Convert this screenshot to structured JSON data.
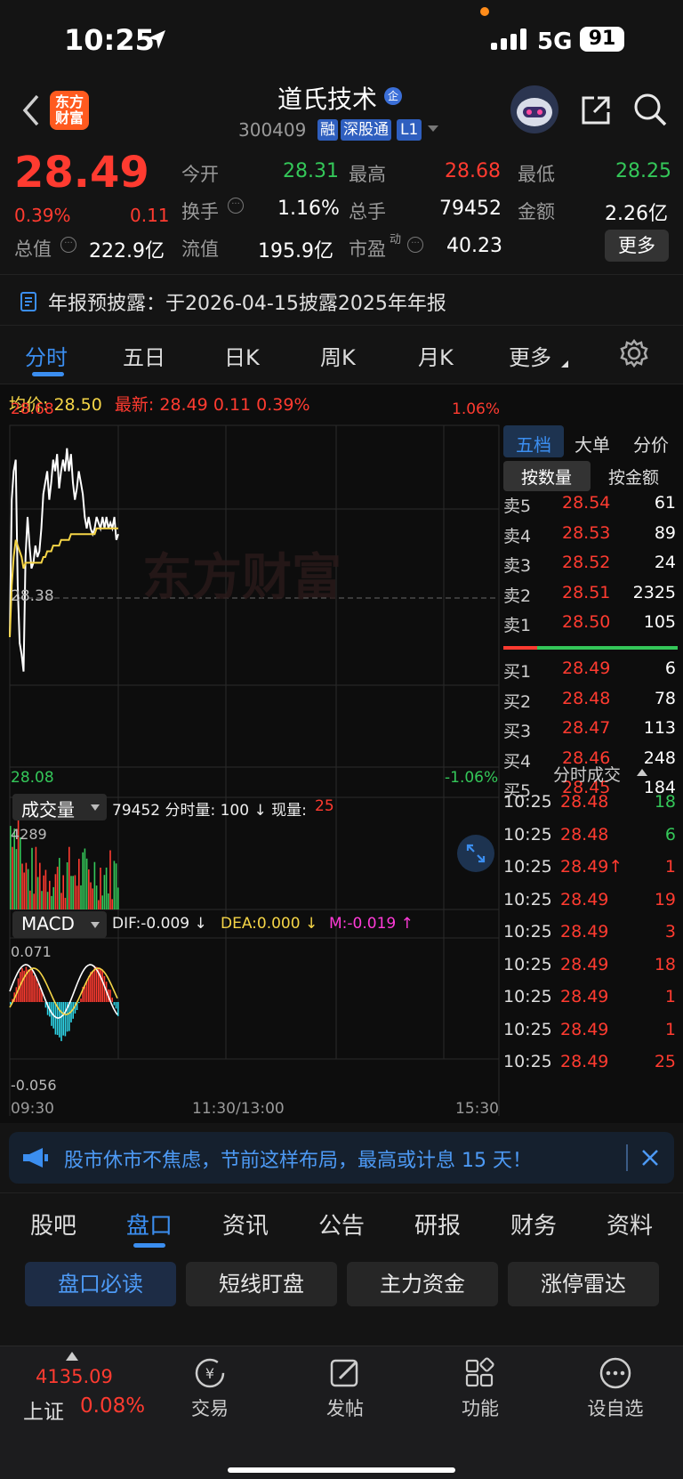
{
  "status_bar": {
    "time": "10:25",
    "network": "5G",
    "battery": "91"
  },
  "header": {
    "logo_text_1": "东方",
    "logo_text_2": "财富",
    "stock_name": "道氏技术",
    "qi_badge": "企",
    "stock_code": "300409",
    "tags": [
      "融",
      "深股通",
      "L1"
    ]
  },
  "quote": {
    "price": "28.49",
    "change_pct": "0.39%",
    "change_amt": "0.11",
    "open_label": "今开",
    "open": "28.31",
    "high_label": "最高",
    "high": "28.68",
    "low_label": "最低",
    "low": "28.25",
    "turnover_label": "换手",
    "turnover": "1.16%",
    "volume_label": "总手",
    "volume": "79452",
    "amount_label": "金额",
    "amount": "2.26亿",
    "mktcap_label": "总值",
    "mktcap": "222.9亿",
    "float_label": "流值",
    "float": "195.9亿",
    "pe_label": "市盈",
    "pe_sup": "动",
    "pe": "40.23",
    "more_label": "更多"
  },
  "notice": {
    "text": "年报预披露：于2026-04-15披露2025年年报"
  },
  "chart_tabs": [
    "分时",
    "五日",
    "日K",
    "周K",
    "月K",
    "更多"
  ],
  "info_line": {
    "avg_label": "均价:",
    "avg": "28.50",
    "latest_label": "最新:",
    "latest": "28.49",
    "chg": "0.11",
    "pct": "0.39%"
  },
  "intraday": {
    "y_top": "28.68",
    "y_mid": "28.38",
    "y_bottom": "28.08",
    "pct_top": "1.06%",
    "pct_bottom": "-1.06%",
    "watermark": "东方财富",
    "volume_label": "成交量",
    "volume_info_1": "79452 分时量: 100 ↓ 现量:",
    "volume_info_2": "25",
    "volume_max": "4289",
    "macd_label": "MACD",
    "dif": "DIF:-0.009 ↓",
    "dea": "DEA:0.000 ↓",
    "m": "M:-0.019 ↑",
    "macd_top": "0.071",
    "macd_bottom": "-0.056",
    "time_start": "09:30",
    "time_mid": "11:30/13:00",
    "time_end": "15:30"
  },
  "chart_data": {
    "type": "line",
    "x": [
      "09:30",
      "09:31",
      "09:32",
      "09:33",
      "09:34",
      "09:35",
      "09:36",
      "09:37",
      "09:38",
      "09:39",
      "09:40",
      "09:41",
      "09:42",
      "09:43",
      "09:44",
      "09:45",
      "09:46",
      "09:47",
      "09:48",
      "09:49",
      "09:50",
      "09:51",
      "09:52",
      "09:53",
      "09:54",
      "09:55",
      "09:56",
      "09:57",
      "09:58",
      "09:59",
      "10:00",
      "10:01",
      "10:02",
      "10:03",
      "10:04",
      "10:05",
      "10:06",
      "10:07",
      "10:08",
      "10:09",
      "10:10",
      "10:11",
      "10:12",
      "10:13",
      "10:14",
      "10:15",
      "10:16",
      "10:17",
      "10:18",
      "10:19",
      "10:20",
      "10:21",
      "10:22",
      "10:23",
      "10:24",
      "10:25"
    ],
    "series": [
      {
        "name": "最新",
        "values": [
          28.31,
          28.55,
          28.6,
          28.62,
          28.4,
          28.3,
          28.28,
          28.25,
          28.45,
          28.52,
          28.47,
          28.43,
          28.44,
          28.47,
          28.45,
          28.46,
          28.5,
          28.56,
          28.58,
          28.6,
          28.55,
          28.58,
          28.62,
          28.6,
          28.63,
          28.57,
          28.6,
          28.62,
          28.6,
          28.64,
          28.6,
          28.63,
          28.58,
          28.55,
          28.57,
          28.6,
          28.58,
          28.56,
          28.52,
          28.5,
          28.52,
          28.5,
          28.49,
          28.5,
          28.52,
          28.51,
          28.5,
          28.52,
          28.5,
          28.52,
          28.5,
          28.51,
          28.5,
          28.52,
          28.48,
          28.49
        ]
      },
      {
        "name": "均价",
        "values": [
          28.31,
          28.4,
          28.45,
          28.48,
          28.47,
          28.46,
          28.45,
          28.43,
          28.44,
          28.44,
          28.44,
          28.44,
          28.44,
          28.44,
          28.44,
          28.44,
          28.44,
          28.45,
          28.45,
          28.46,
          28.46,
          28.46,
          28.47,
          28.47,
          28.47,
          28.47,
          28.48,
          28.48,
          28.48,
          28.48,
          28.48,
          28.49,
          28.49,
          28.49,
          28.49,
          28.49,
          28.49,
          28.49,
          28.49,
          28.49,
          28.49,
          28.49,
          28.49,
          28.49,
          28.5,
          28.5,
          28.5,
          28.5,
          28.5,
          28.5,
          28.5,
          28.5,
          28.5,
          28.5,
          28.5,
          28.5
        ]
      }
    ],
    "ylim": [
      28.08,
      28.68
    ]
  },
  "orderbook": {
    "tabs": [
      "五档",
      "大单",
      "分价"
    ],
    "subtabs": [
      "按数量",
      "按金额"
    ],
    "asks": [
      {
        "label": "卖5",
        "price": "28.54",
        "qty": "61"
      },
      {
        "label": "卖4",
        "price": "28.53",
        "qty": "89"
      },
      {
        "label": "卖3",
        "price": "28.52",
        "qty": "24"
      },
      {
        "label": "卖2",
        "price": "28.51",
        "qty": "2325"
      },
      {
        "label": "卖1",
        "price": "28.50",
        "qty": "105"
      }
    ],
    "bids": [
      {
        "label": "买1",
        "price": "28.49",
        "qty": "6"
      },
      {
        "label": "买2",
        "price": "28.48",
        "qty": "78"
      },
      {
        "label": "买3",
        "price": "28.47",
        "qty": "113"
      },
      {
        "label": "买4",
        "price": "28.46",
        "qty": "248"
      },
      {
        "label": "买5",
        "price": "28.45",
        "qty": "184"
      }
    ],
    "ticks_title": "分时成交",
    "ticks": [
      {
        "time": "10:25",
        "price": "28.48",
        "qty": "18",
        "dir": "buy"
      },
      {
        "time": "10:25",
        "price": "28.48",
        "qty": "6",
        "dir": "buy"
      },
      {
        "time": "10:25",
        "price": "28.49↑",
        "qty": "1",
        "dir": "sell"
      },
      {
        "time": "10:25",
        "price": "28.49",
        "qty": "19",
        "dir": "sell"
      },
      {
        "time": "10:25",
        "price": "28.49",
        "qty": "3",
        "dir": "sell"
      },
      {
        "time": "10:25",
        "price": "28.49",
        "qty": "18",
        "dir": "sell"
      },
      {
        "time": "10:25",
        "price": "28.49",
        "qty": "1",
        "dir": "sell"
      },
      {
        "time": "10:25",
        "price": "28.49",
        "qty": "1",
        "dir": "sell"
      },
      {
        "time": "10:25",
        "price": "28.49",
        "qty": "25",
        "dir": "sell"
      }
    ]
  },
  "banner": {
    "text": "股市休市不焦虑，节前这样布局，最高或计息 15 天！"
  },
  "bottom_tabs": [
    "股吧",
    "盘口",
    "资讯",
    "公告",
    "研报",
    "财务",
    "资料"
  ],
  "sub_tabs": [
    "盘口必读",
    "短线盯盘",
    "主力资金",
    "涨停雷达"
  ],
  "nav": {
    "index_value": "4135.09",
    "index_name": "上证",
    "index_pct": "0.08%",
    "items": [
      "交易",
      "发帖",
      "功能",
      "设自选"
    ]
  },
  "colors": {
    "up": "#ff3b30",
    "down": "#34c759",
    "accent": "#3b8ef0",
    "avg_line": "#f5d547"
  }
}
